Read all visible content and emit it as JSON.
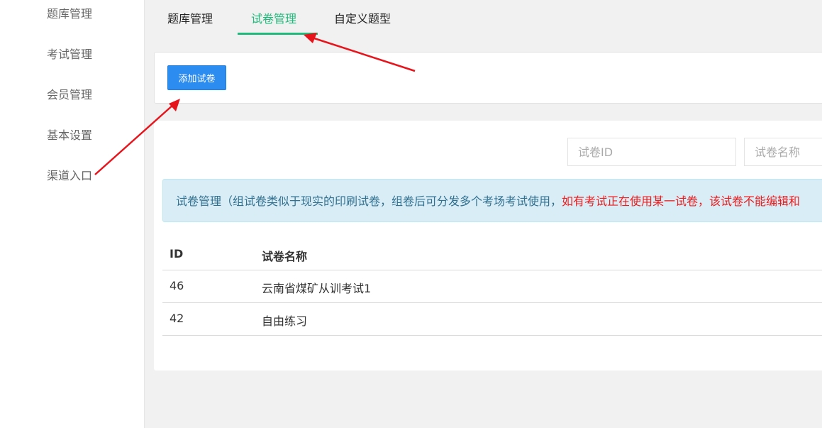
{
  "sidebar": {
    "items": [
      {
        "label": "题库管理"
      },
      {
        "label": "考试管理"
      },
      {
        "label": "会员管理"
      },
      {
        "label": "基本设置"
      },
      {
        "label": "渠道入口"
      }
    ]
  },
  "tabs": [
    {
      "label": "题库管理",
      "active": false
    },
    {
      "label": "试卷管理",
      "active": true
    },
    {
      "label": "自定义题型",
      "active": false
    }
  ],
  "toolbar": {
    "add_label": "添加试卷"
  },
  "search": {
    "id_placeholder": "试卷ID",
    "name_placeholder": "试卷名称"
  },
  "notice": {
    "text": "试卷管理（组试卷类似于现实的印刷试卷，组卷后可分发多个考场考试使用，",
    "warning": "如有考试正在使用某一试卷，该试卷不能编辑和"
  },
  "table": {
    "headers": [
      "ID",
      "试卷名称"
    ],
    "rows": [
      {
        "id": "46",
        "name": "云南省煤矿从训考试1"
      },
      {
        "id": "42",
        "name": "自由练习"
      }
    ]
  },
  "colors": {
    "accent_green": "#1fb97b",
    "button_blue": "#2d8cf0",
    "annotation_red": "#e8141c"
  }
}
